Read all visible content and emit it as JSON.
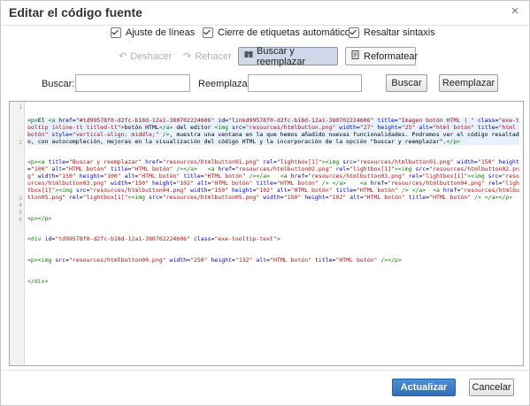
{
  "dialog": {
    "title": "Editar el código fuente",
    "close_glyph": "×"
  },
  "options": [
    {
      "label": "Ajuste de líneas",
      "checked": true
    },
    {
      "label": "Cierre de etiquetas automático",
      "checked": true
    },
    {
      "label": "Resaltar sintaxis",
      "checked": true
    }
  ],
  "toolbar": {
    "undo_label": "Deshacer",
    "redo_label": "Rehacer",
    "find_replace_label": "Buscar y reemplazar",
    "reformat_label": "Reformatear",
    "undo_icon": "undo-icon",
    "redo_icon": "redo-icon",
    "find_replace_icon": "find-replace-icon",
    "reformat_icon": "reformat-icon"
  },
  "search": {
    "find_label": "Buscar:",
    "find_value": "",
    "replace_label": "Reemplazar:",
    "replace_value": "",
    "find_button": "Buscar",
    "replace_button": "Reemplazar"
  },
  "editor": {
    "line_numbers": [
      "1",
      "2",
      "3",
      "4",
      "5",
      "6"
    ],
    "lines": [
      "<p>El <a href=\"#td99578f0-d2fc-b18d-12a1-380702224606\" id=\"linkd99578f0-d2fc-b18d-12a1-380702224606\" title=\"Imagen botón HTML | \" class=\"exe-tooltip inline-tt titled-tt\">botón HTML</a> del editor <img src=\"resources/htmlbutton.png\" width=\"27\" height=\"25\" alt=\"html botón\" title=\"html botón\" style=\"vertical-align: middle;\" />, muestra una ventana en la que hemos añadido nuevas funcionalidades. Podremos ver el código resaltado, con autocompleción, mejoras en la visualización del código HTML y la incorporación de la opción \"buscar y reemplazar\".</p>",
      "<p><a title=\"Buscar y reemplazar\" href=\"resources/htmlbutton01.png\" rel=\"lightbox[1]\"><img src=\"resources/htmlbutton01.png\" width=\"150\" height=\"100\" alt=\"HTML botón\" title=\"HTML botón\" /></a>   <a href=\"resources/htmlbutton02.png\" rel=\"lightbox[1]\"><img src=\"resources/htmlbutton02.png\" width=\"150\" height=\"100\" alt=\"HTML botón\" title=\"HTML botón\" /></a>   <a href=\"resources/htmlbutton03.png\" rel=\"lightbox[1]\"><img src=\"resources/htmlbutton03.png\" width=\"150\" height=\"102\" alt=\"HTML botón\" title=\"HTML botón\" /> </a>    <a href=\"resources/htmlbutton04.png\" rel=\"lightbox[1]\"><img src=\"resources/htmlbutton04.png\" width=\"150\" height=\"102\" alt=\"HTML botón\" title=\"HTML botón\" /> </a>  <a href=\"resources/htmlbutton05.png\" rel=\"lightbox[1]\"><img src=\"resources/htmlbutton05.png\" width=\"150\" height=\"102\" alt=\"HTML botón\" title=\"HTML botón\" /> </a></p>",
      "<p></p>",
      "<div id=\"td99578f0-d2fc-b18d-12a1-380702224606\" class=\"exe-tooltip-text\">",
      "<p><img src=\"resources/htmlbutton00.png\" width=\"250\" height=\"132\" alt=\"HTML botón\" title=\"HTML botón\" /></p>",
      "</div>"
    ]
  },
  "footer": {
    "update_button": "Actualizar",
    "cancel_button": "Cancelar"
  },
  "colors": {
    "primary_button": "#3a7cc8",
    "active_tool": "#cfd8e8",
    "tag_color": "#117700",
    "attr_color": "#0000cc",
    "string_color": "#aa1111"
  }
}
